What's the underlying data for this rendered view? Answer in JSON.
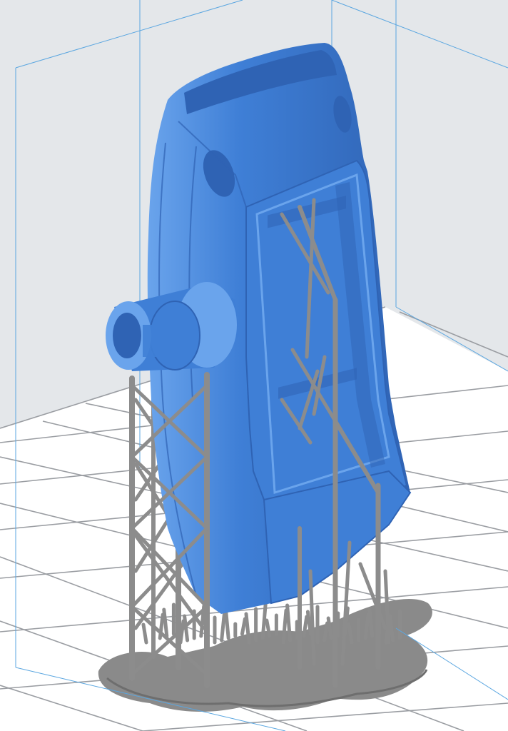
{
  "viewport": {
    "background_color": "#e4e7ea",
    "floor_color": "#ffffff",
    "grid_line_color": "#9a9da2",
    "build_volume_line_color": "#5aa6e0"
  },
  "model": {
    "body_color": "#3f7fd6",
    "body_highlight_color": "#6aa4ec",
    "body_shadow_color": "#2f63b4",
    "support_color": "#8c8c8c",
    "support_dark_color": "#6e6e6e",
    "raft_color": "#8a8a8a"
  }
}
